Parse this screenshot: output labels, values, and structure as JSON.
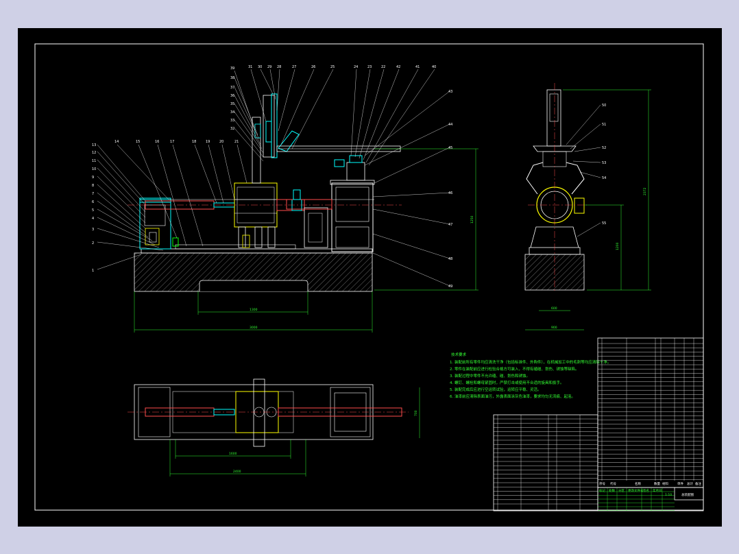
{
  "drawing": {
    "tech_requirements": {
      "title": "技术要求",
      "lines": [
        "1. 装配前所有零件均应清洗干净（包括标准件、外购件），在机械加工中的毛刺等均应清除干净。",
        "2. 零件在装配前应进行检验合格方可装入，不得有磕碰、划伤、锈蚀等缺陷。",
        "3. 装配过程中零件不允许磕、碰、划伤和锈蚀。",
        "4. 螺钉、螺栓和螺母紧固时，严禁打击或使用不合适的旋具和扳手。",
        "5. 装配完成后应进行空运转试验，运转应平稳、灵活。",
        "6. 油漆前应清除表面油污，外露表面涂灰色油漆，要求均匀无流痕、起泡。"
      ]
    },
    "front_view_labels_left": [
      "1",
      "2",
      "3",
      "4",
      "5",
      "6",
      "7",
      "8",
      "9",
      "10",
      "11",
      "12",
      "13"
    ],
    "front_view_labels_top": [
      "14",
      "15",
      "16",
      "17",
      "18",
      "19",
      "20",
      "21",
      "22",
      "23",
      "24",
      "25",
      "26",
      "27",
      "28",
      "29",
      "30",
      "31",
      "32",
      "33",
      "34",
      "35",
      "36",
      "37",
      "38",
      "39",
      "40",
      "41",
      "42"
    ],
    "front_view_labels_right": [
      "43",
      "44",
      "45",
      "46",
      "47",
      "48",
      "49"
    ],
    "side_view_labels": [
      "50",
      "51",
      "52",
      "53",
      "54",
      "55"
    ],
    "dimensions": {
      "base_length": "3000",
      "base_opening": "1300",
      "height_total": "1250",
      "side_height_total": "2372",
      "side_height_mid": "1200",
      "side_width": "600",
      "side_base": "900",
      "plan_width": "700",
      "plan_length_1": "1600",
      "plan_length_2": "2400"
    },
    "title_block": {
      "drawing_name": "总装配图",
      "scale": "1:10",
      "headers": [
        "序号",
        "代号",
        "名称",
        "数量",
        "材料",
        "单件",
        "总计",
        "备注"
      ],
      "sign_row": [
        "标记",
        "处数",
        "分区",
        "更改文件号",
        "签名",
        "年月日"
      ]
    }
  }
}
